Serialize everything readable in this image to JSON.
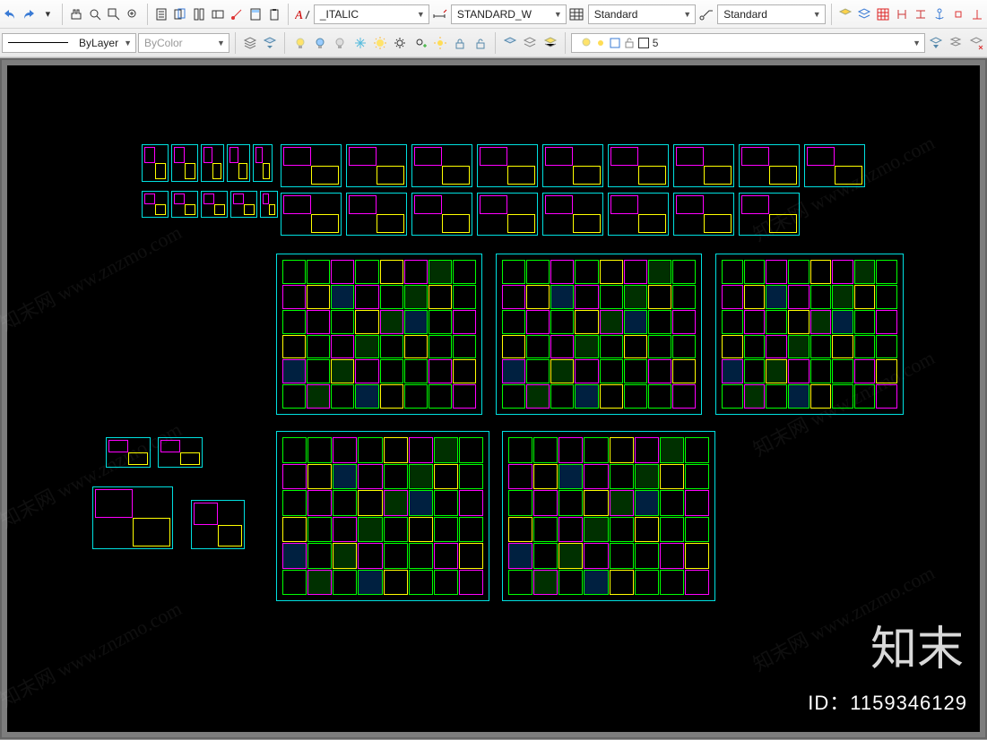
{
  "toolbar1": {
    "textstyle": "_ITALIC",
    "dimstyle": "STANDARD_W",
    "tablestyle": "Standard",
    "mleaderstyle": "Standard"
  },
  "toolbar2": {
    "linetype_label": "ByLayer",
    "lineweight_label": "ByColor",
    "layer_state": "5"
  },
  "watermark": {
    "line1": "知末网 www.znzmo.com",
    "brand": "知末",
    "id_label": "ID：1159346129"
  }
}
